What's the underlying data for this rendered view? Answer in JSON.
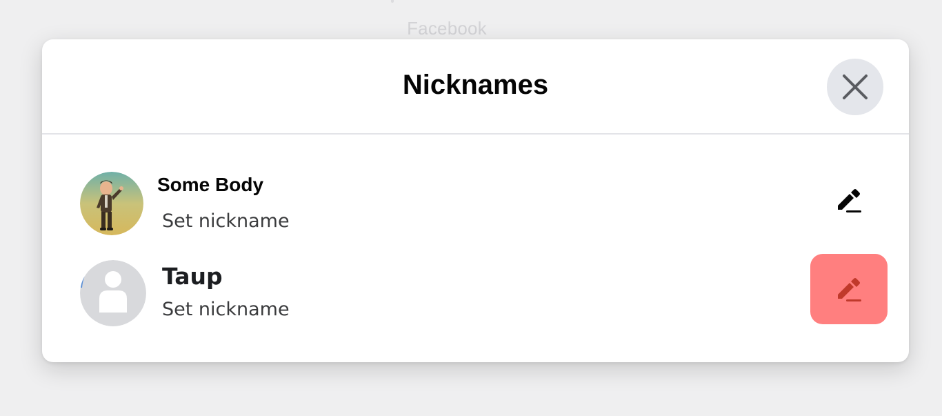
{
  "background": {
    "label": "Facebook"
  },
  "modal": {
    "title": "Nicknames",
    "close_icon": "close-icon"
  },
  "participants": [
    {
      "name": "Some Body",
      "subtitle": "Set nickname",
      "avatar": "bitmoji-avatar",
      "edit_icon": "pencil-icon"
    },
    {
      "name": "Taup",
      "subtitle": "Set nickname",
      "avatar": "default-profile-avatar",
      "edit_icon": "pencil-icon",
      "edit_highlighted": true
    }
  ],
  "colors": {
    "page_bg": "#efeff0",
    "modal_bg": "#ffffff",
    "close_bg": "#e4e6eb",
    "highlight_bg": "#ff7f7f",
    "highlight_icon": "#c0392b",
    "text_primary": "#050505",
    "text_secondary": "#3a3b3d"
  }
}
